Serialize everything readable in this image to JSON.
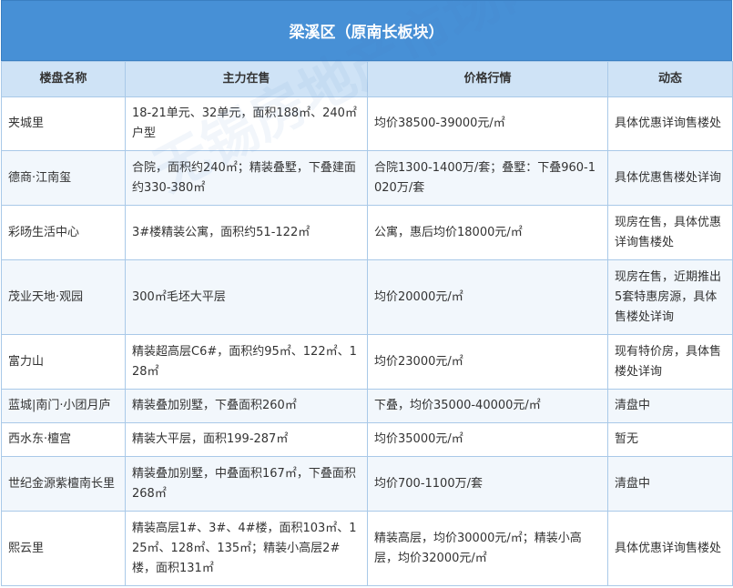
{
  "title": "梁溪区（原南长板块）",
  "columns": [
    "楼盘名称",
    "主力在售",
    "价格行情",
    "动态"
  ],
  "rows": [
    {
      "name": "夹城里",
      "supply": "18-21单元、32单元，面积188㎡、240㎡户型",
      "price": "均价38500-39000元/㎡",
      "status": "具体优惠详询售楼处"
    },
    {
      "name": "德商·江南玺",
      "supply": "合院，面积约240㎡；精装叠墅，下叠建面约330-380㎡",
      "price": "合院1300-1400万/套；叠墅：下叠960-1020万/套",
      "status": "具体优惠售楼处详询"
    },
    {
      "name": "彩旸生活中心",
      "supply": "3#楼精装公寓，面积约51-122㎡",
      "price": "公寓，惠后均价18000元/㎡",
      "status": "现房在售，具体优惠详询售楼处"
    },
    {
      "name": "茂业天地·观园",
      "supply": "300㎡毛坯大平层",
      "price": "均价20000元/㎡",
      "status": "现房在售，近期推出5套特惠房源，具体售楼处详询"
    },
    {
      "name": "富力山",
      "supply": "精装超高层C6#，面积约95㎡、122㎡、128㎡",
      "price": "均价23000元/㎡",
      "status": "现有特价房，具体售楼处详询"
    },
    {
      "name": "蓝城|南门·小团月庐",
      "supply": "精装叠加别墅，下叠面积260㎡",
      "price": "下叠，均价35000-40000元/㎡",
      "status": "清盘中"
    },
    {
      "name": "西水东·檀宫",
      "supply": "精装大平层，面积199-287㎡",
      "price": "均价35000元/㎡",
      "status": "暂无"
    },
    {
      "name": "世纪金源紫檀南长里",
      "supply": "精装叠加别墅，中叠面积167㎡，下叠面积268㎡",
      "price": "均价700-1100万/套",
      "status": "清盘中"
    },
    {
      "name": "熙云里",
      "supply": "精装高层1#、3#、4#楼，面积103㎡、125㎡、128㎡、135㎡；精装小高层2#楼，面积131㎡",
      "price": "精装高层，均价30000元/㎡；精装小高层，均价32000元/㎡",
      "status": "具体优惠详询售楼处"
    }
  ],
  "watermark": "无锡房地产市场网 wxhouse.com"
}
